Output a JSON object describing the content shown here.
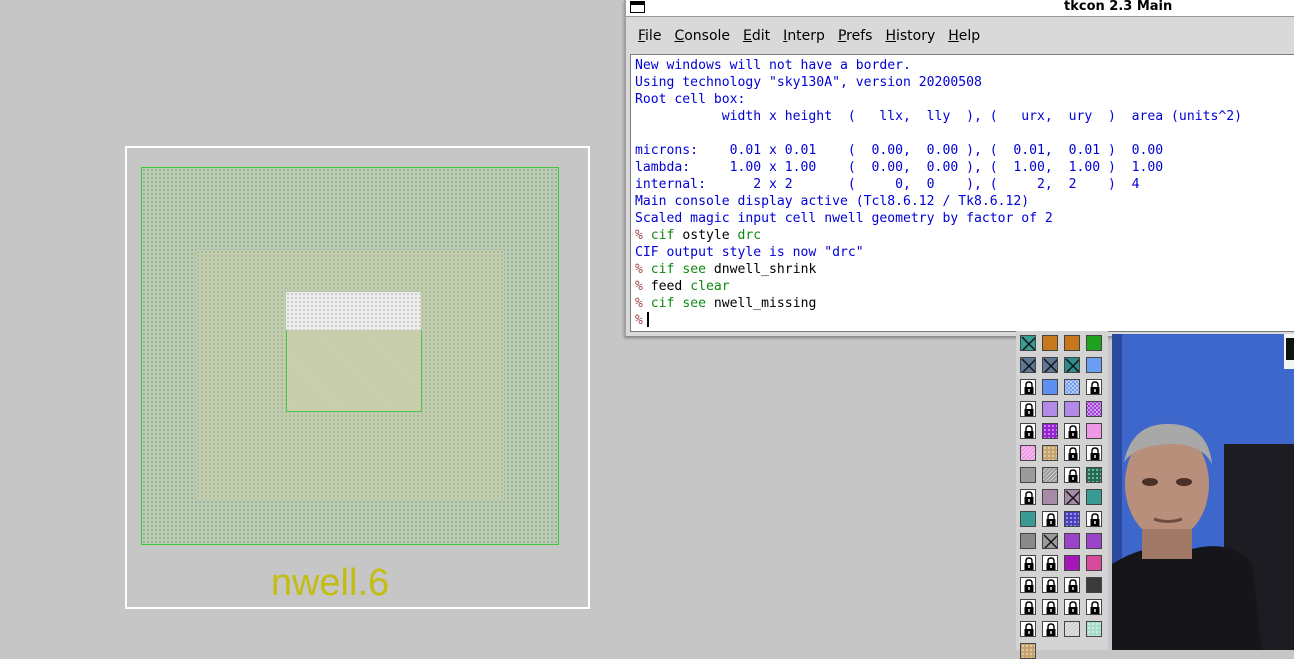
{
  "layout": {
    "drc_label": "nwell.6"
  },
  "tkcon": {
    "title": "tkcon 2.3 Main",
    "menu": [
      {
        "label": "File",
        "hot": "F",
        "rest": "ile"
      },
      {
        "label": "Console",
        "hot": "C",
        "rest": "onsole"
      },
      {
        "label": "Edit",
        "hot": "E",
        "rest": "dit"
      },
      {
        "label": "Interp",
        "hot": "I",
        "rest": "nterp"
      },
      {
        "label": "Prefs",
        "hot": "P",
        "rest": "refs"
      },
      {
        "label": "History",
        "hot": "H",
        "rest": "istory"
      },
      {
        "label": "Help",
        "hot": "H",
        "rest": "elp"
      }
    ],
    "console_lines": [
      {
        "kind": "out",
        "text": "New windows will not have a border."
      },
      {
        "kind": "out",
        "text": "Using technology \"sky130A\", version 20200508"
      },
      {
        "kind": "out",
        "text": "Root cell box:"
      },
      {
        "kind": "out",
        "text": "           width x height  (   llx,  lly  ), (   urx,  ury  )  area (units^2)"
      },
      {
        "kind": "out",
        "text": ""
      },
      {
        "kind": "out",
        "text": "microns:    0.01 x 0.01    (  0.00,  0.00 ), (  0.01,  0.01 )  0.00"
      },
      {
        "kind": "out",
        "text": "lambda:     1.00 x 1.00    (  0.00,  0.00 ), (  1.00,  1.00 )  1.00"
      },
      {
        "kind": "out",
        "text": "internal:      2 x 2       (     0,  0    ), (     2,  2    )  4"
      },
      {
        "kind": "out",
        "text": "Main console display active (Tcl8.6.12 / Tk8.6.12)"
      },
      {
        "kind": "out",
        "text": "Scaled magic input cell nwell geometry by factor of 2"
      },
      {
        "kind": "cmd",
        "cmd": "cif",
        "args": "ostyle",
        "arg2": "drc"
      },
      {
        "kind": "out",
        "text": "CIF output style is now \"drc\""
      },
      {
        "kind": "cmd",
        "cmd": "cif see",
        "args": "dnwell_shrink",
        "arg2": ""
      },
      {
        "kind": "cmd",
        "cmd": "",
        "args": "feed",
        "arg2": "clear"
      },
      {
        "kind": "cmd",
        "cmd": "cif see",
        "args": "nwell_missing",
        "arg2": ""
      },
      {
        "kind": "prompt"
      }
    ],
    "prompt_symbol": "%"
  },
  "palette": {
    "rows": [
      [
        "x-teal",
        "solid-orange",
        "solid-orange",
        "solid-green"
      ],
      [
        "x-slate",
        "x-slate",
        "x-teal2",
        "solid-skyblue"
      ],
      [
        "lock",
        "solid-blue",
        "check-blue",
        "lock"
      ],
      [
        "lock",
        "solid-lavender",
        "solid-lavender",
        "check-purple"
      ],
      [
        "lock",
        "dots-purple",
        "lock",
        "solid-pink"
      ],
      [
        "hatch-pink",
        "dots-tan",
        "lock",
        "lock"
      ],
      [
        "solid-gray",
        "hatch-gray",
        "lock",
        "dots-darkgreen"
      ],
      [
        "lock",
        "solid-mauve",
        "x-mauve",
        "solid-teal"
      ],
      [
        "solid-teal",
        "lock",
        "dots-navy",
        "lock"
      ],
      [
        "solid-gray2",
        "x-gray",
        "solid-violet",
        "solid-violet"
      ],
      [
        "lock",
        "lock",
        "solid-magenta",
        "solid-rose"
      ],
      [
        "lock",
        "lock",
        "lock",
        "solid-dark"
      ],
      [
        "lock",
        "lock",
        "lock",
        "lock"
      ],
      [
        "lock",
        "lock",
        "hatch-light",
        "dots-mint"
      ]
    ]
  }
}
